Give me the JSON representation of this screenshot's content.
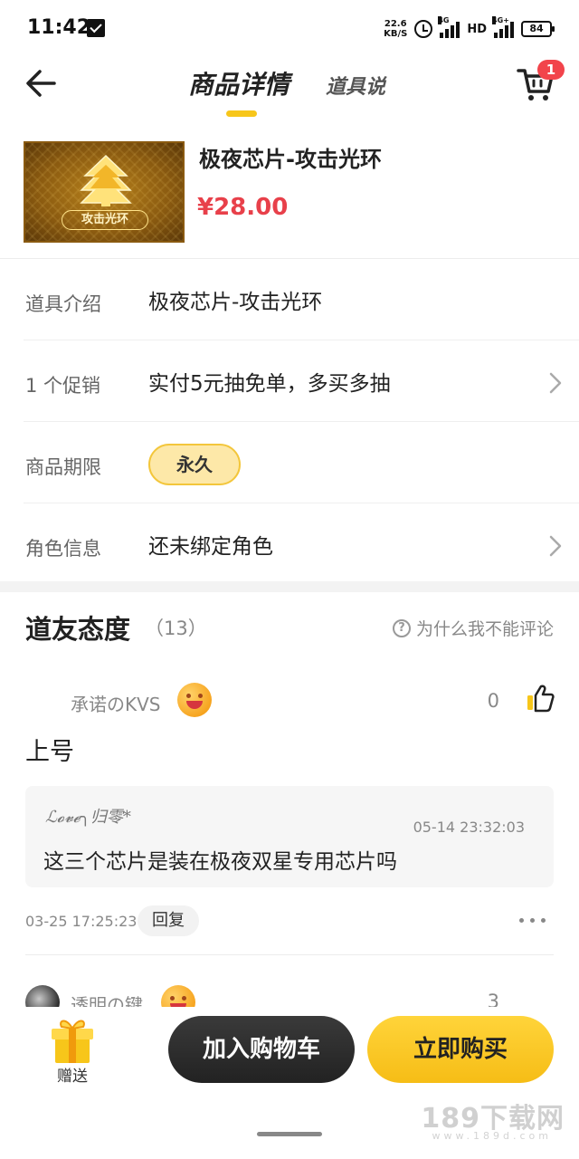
{
  "status_bar": {
    "time": "11:42",
    "speed_value": "22.6",
    "speed_unit": "KB/S",
    "network": "4G",
    "hd": "HD",
    "network2": "4G+",
    "battery": "84"
  },
  "nav": {
    "tab_active": "商品详情",
    "tab_other": "道具说",
    "cart_badge": "1"
  },
  "product": {
    "title": "极夜芯片-攻击光环",
    "price": "¥28.00",
    "thumb_label": "攻击光环"
  },
  "info_rows": [
    {
      "key": "道具介绍",
      "value": "极夜芯片-攻击光环"
    },
    {
      "key": "1 个促销",
      "value": "实付5元抽免单，多买多抽"
    },
    {
      "key": "商品期限",
      "value": "永久"
    },
    {
      "key": "角色信息",
      "value": "还未绑定角色"
    }
  ],
  "comments_section": {
    "title": "道友态度",
    "count": "（13）",
    "why_link": "为什么我不能评论"
  },
  "comments": [
    {
      "user": "承诺のKVS",
      "likes": "0",
      "text": "上号",
      "time": "03-25 17:25:23",
      "reply_label": "回复",
      "reply": {
        "user": "ℒ𝓸𝓿𝓮╮归零*",
        "time": "05-14 23:32:03",
        "text": "这三个芯片是装在极夜双星专用芯片吗"
      }
    },
    {
      "user": "透明の键",
      "likes": "3"
    }
  ],
  "bottom_bar": {
    "gift_label": "赠送",
    "add_to_cart": "加入购物车",
    "buy_now": "立即购买"
  },
  "watermark": {
    "main": "189下载网",
    "sub": "www.189d.com"
  },
  "colors": {
    "accent_yellow": "#f7c61a",
    "price_red": "#e8404a",
    "badge_red": "#f2444b",
    "dark_button": "#2b2b2b"
  }
}
